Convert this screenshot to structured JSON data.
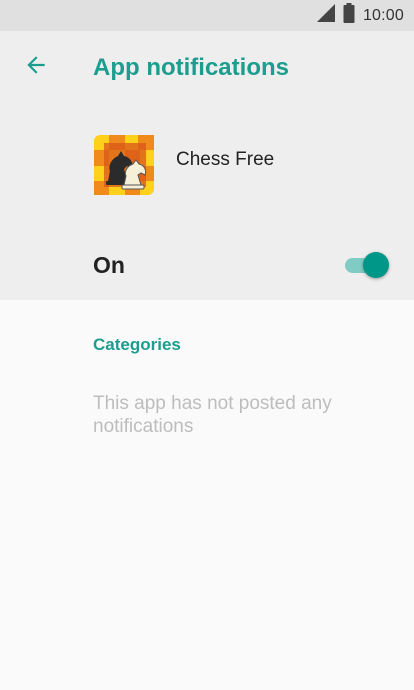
{
  "status_bar": {
    "time": "10:00",
    "icons": [
      "signal-icon",
      "battery-icon"
    ]
  },
  "app_bar": {
    "back_icon": "arrow-back-icon",
    "title": "App notifications"
  },
  "app": {
    "name": "Chess Free",
    "icon": "chess-app-icon"
  },
  "master_toggle": {
    "label": "On",
    "state": true
  },
  "categories": {
    "header": "Categories",
    "empty_message": "This app has not posted any notifications"
  },
  "colors": {
    "accent": "#1b9e8e",
    "toggle_thumb": "#009688",
    "toggle_track": "#80cbc4",
    "header_background": "#eeeeee",
    "status_bar_background": "#e0e0e0",
    "page_background": "#fafafa",
    "empty_text": "#bdbdbd"
  }
}
